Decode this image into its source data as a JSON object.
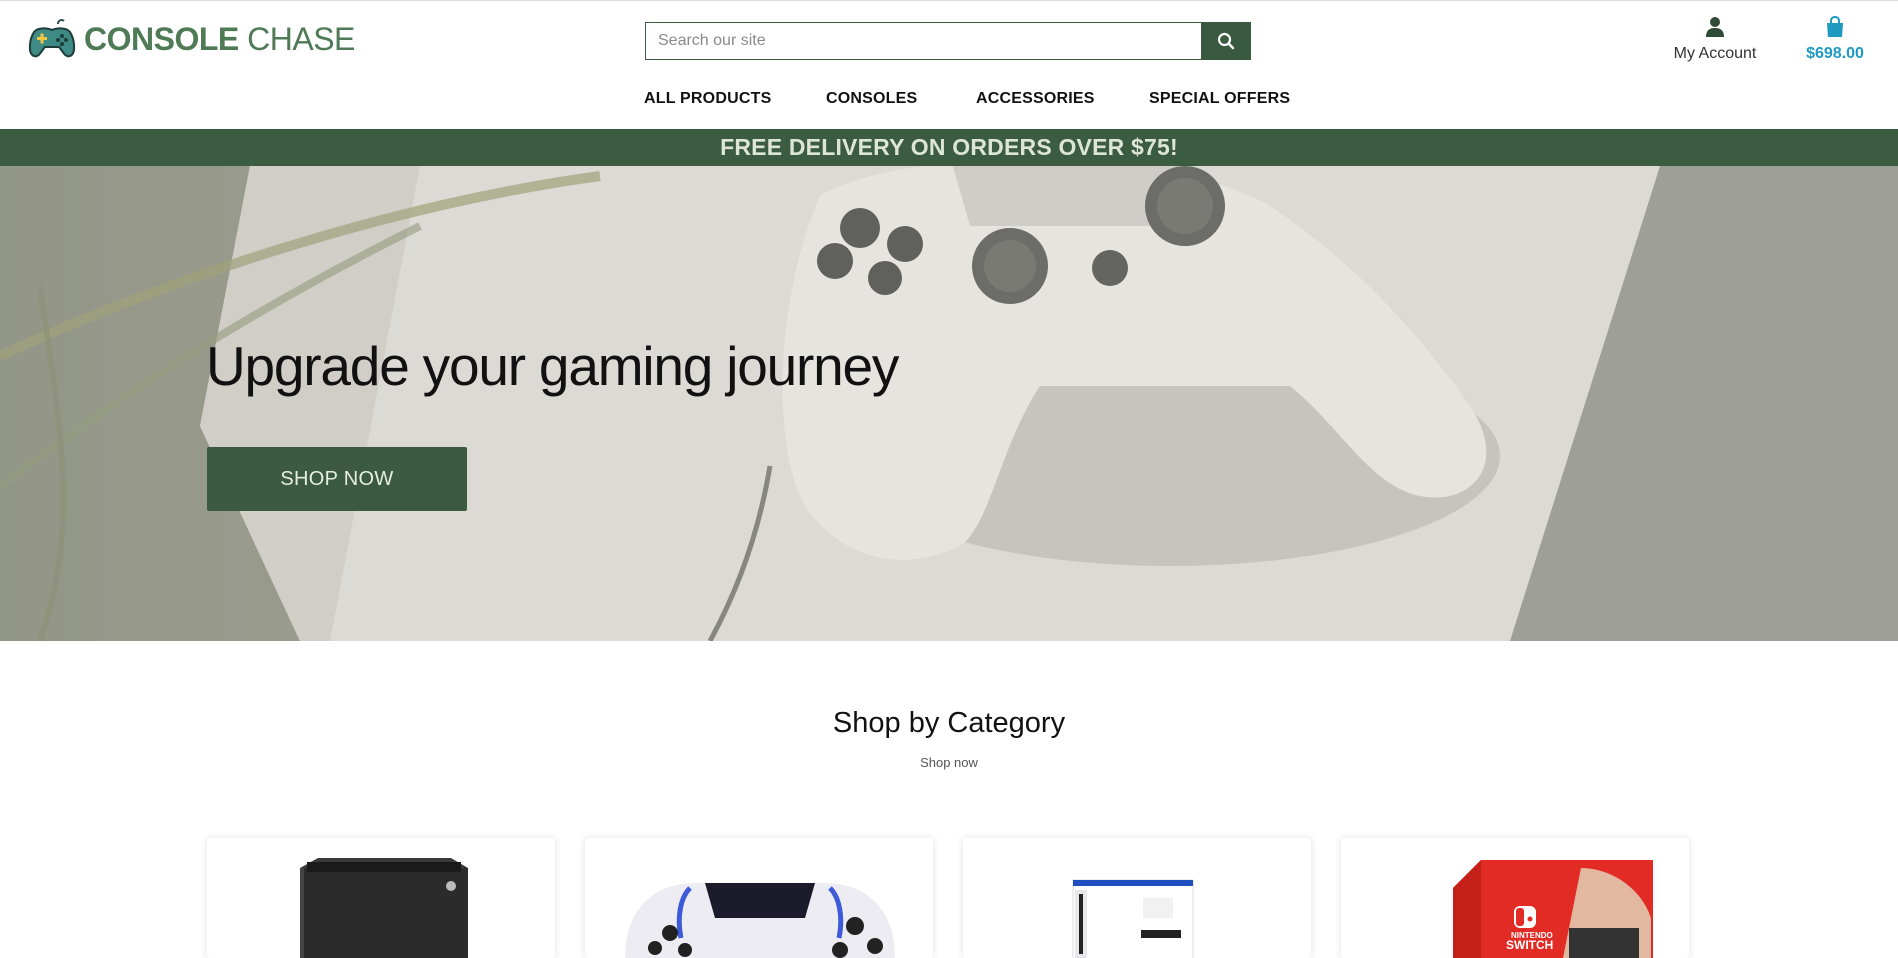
{
  "header": {
    "logo": {
      "brand_bold": "CONSOLE",
      "brand_regular": "CHASE",
      "icon": "gamepad-icon"
    },
    "search": {
      "placeholder": "Search our site",
      "icon": "search-icon"
    },
    "account": {
      "label": "My Account",
      "icon": "user-icon"
    },
    "cart": {
      "amount": "$698.00",
      "icon": "shopping-bag-icon"
    }
  },
  "nav": {
    "items": [
      {
        "label": "ALL PRODUCTS"
      },
      {
        "label": "CONSOLES"
      },
      {
        "label": "ACCESSORIES"
      },
      {
        "label": "SPECIAL OFFERS"
      }
    ]
  },
  "banner": {
    "text": "FREE DELIVERY ON ORDERS OVER $75!"
  },
  "hero": {
    "title": "Upgrade your gaming journey",
    "button_label": "SHOP NOW",
    "image": "white-game-controller-photo"
  },
  "categories": {
    "title": "Shop by Category",
    "subtitle": "Shop now",
    "cards": [
      {
        "image": "xbox-series-x-console"
      },
      {
        "image": "ps5-dualsense-edge-controller"
      },
      {
        "image": "ps5-slim-box"
      },
      {
        "image": "nintendo-switch-oled-box",
        "box_text_1": "NINTENDO",
        "box_text_2": "SWITCH"
      }
    ]
  },
  "colors": {
    "brand_green": "#3b5c41",
    "logo_green": "#4f7a56",
    "cart_blue": "#1e9ac0",
    "banner_text": "#dde6d6"
  }
}
